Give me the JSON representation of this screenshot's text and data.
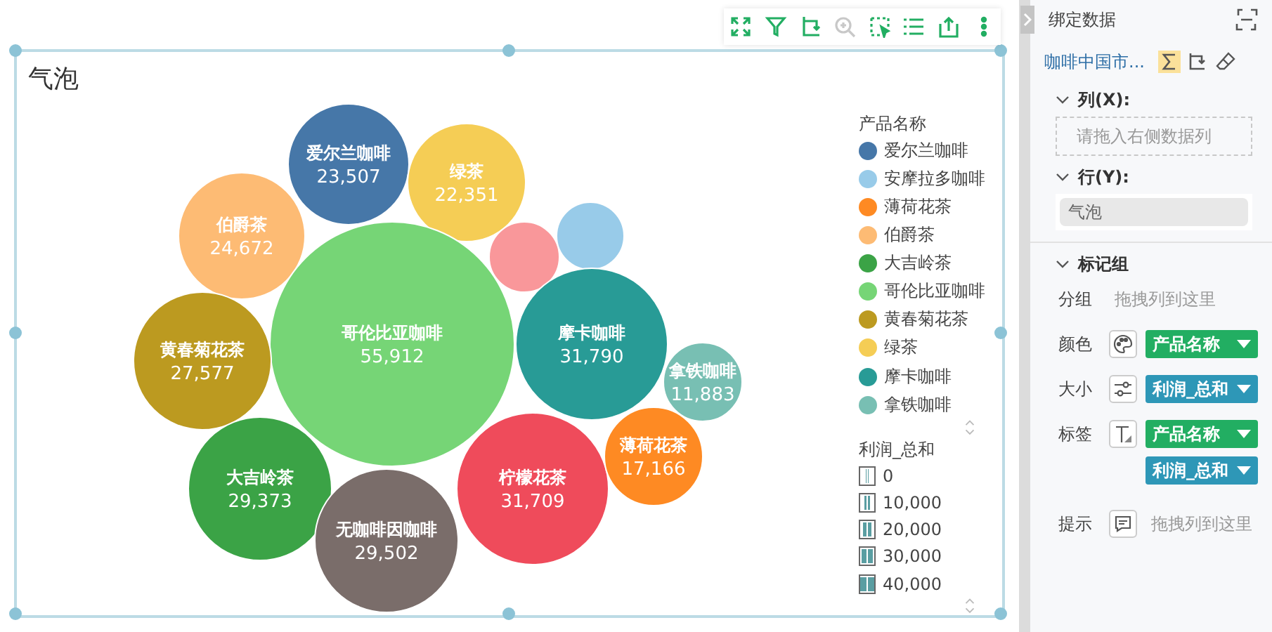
{
  "toolbar": [
    {
      "kind": "expand",
      "disabled": false
    },
    {
      "kind": "filter",
      "disabled": false
    },
    {
      "kind": "swap",
      "disabled": false
    },
    {
      "kind": "zoom",
      "disabled": true
    },
    {
      "kind": "select",
      "disabled": false
    },
    {
      "kind": "list",
      "disabled": false
    },
    {
      "kind": "export",
      "disabled": false
    },
    {
      "kind": "more",
      "disabled": false
    }
  ],
  "chart": {
    "title": "气泡",
    "bubbles": [
      {
        "label": "爱尔兰咖啡",
        "value": "23,507",
        "color": "#4677a8"
      },
      {
        "label": "绿茶",
        "value": "22,351",
        "color": "#f5cd55"
      },
      {
        "label": "伯爵茶",
        "value": "24,672",
        "color": "#fdbb74"
      },
      {
        "label": "哥伦比亚咖啡",
        "value": "55,912",
        "color": "#76d576"
      },
      {
        "color": "#f9979a"
      },
      {
        "color": "#98cbe9"
      },
      {
        "label": "摩卡咖啡",
        "value": "31,790",
        "color": "#289b96"
      },
      {
        "label": "拿铁咖啡",
        "value": "11,883",
        "color": "#78bfb3"
      },
      {
        "label": "黄春菊花茶",
        "value": "27,577",
        "color": "#bc9a20"
      },
      {
        "label": "大吉岭茶",
        "value": "29,373",
        "color": "#3ba346"
      },
      {
        "label": "无咖啡因咖啡",
        "value": "29,502",
        "color": "#7a6d6a"
      },
      {
        "label": "柠檬花茶",
        "value": "31,709",
        "color": "#ef4b5b"
      },
      {
        "label": "薄荷花茶",
        "value": "17,166",
        "color": "#fe8a23"
      }
    ],
    "color_legend": {
      "title": "产品名称",
      "items": [
        {
          "label": "爱尔兰咖啡",
          "color": "#4677a8"
        },
        {
          "label": "安摩拉多咖啡",
          "color": "#98cbe9"
        },
        {
          "label": "薄荷花茶",
          "color": "#fe8a23"
        },
        {
          "label": "伯爵茶",
          "color": "#fdbb74"
        },
        {
          "label": "大吉岭茶",
          "color": "#3ba346"
        },
        {
          "label": "哥伦比亚咖啡",
          "color": "#76d576"
        },
        {
          "label": "黄春菊花茶",
          "color": "#bc9a20"
        },
        {
          "label": "绿茶",
          "color": "#f5cd55"
        },
        {
          "label": "摩卡咖啡",
          "color": "#289b96"
        },
        {
          "label": "拿铁咖啡",
          "color": "#78bfb3"
        }
      ]
    },
    "size_legend": {
      "title": "利润_总和",
      "items": [
        {
          "label": "0"
        },
        {
          "label": "10,000"
        },
        {
          "label": "20,000"
        },
        {
          "label": "30,000"
        },
        {
          "label": "40,000"
        }
      ]
    }
  },
  "panel": {
    "title": "绑定数据",
    "dataset": "咖啡中国市...",
    "sum_selected": true,
    "columns": {
      "label": "列(X):",
      "expanded": true,
      "placeholder": "请拖入右侧数据列"
    },
    "rows": {
      "label": "行(Y):",
      "expanded": true,
      "value": "气泡"
    },
    "marks": {
      "label": "标记组",
      "expanded": true,
      "slots": [
        {
          "label": "分组",
          "kind": "plain",
          "placeholder": "拖拽列到这里"
        },
        {
          "label": "颜色",
          "kind": "color",
          "chips": [
            {
              "text": "产品名称",
              "kind": "dimension"
            }
          ]
        },
        {
          "label": "大小",
          "kind": "size",
          "chips": [
            {
              "text": "利润_总和",
              "kind": "measure"
            }
          ]
        },
        {
          "label": "标签",
          "kind": "label",
          "chips": [
            {
              "text": "产品名称",
              "kind": "dimension"
            },
            {
              "text": "利润_总和",
              "kind": "measure"
            }
          ]
        },
        {
          "label": "提示",
          "kind": "tooltip",
          "placeholder": "拖拽列到这里"
        }
      ]
    }
  }
}
